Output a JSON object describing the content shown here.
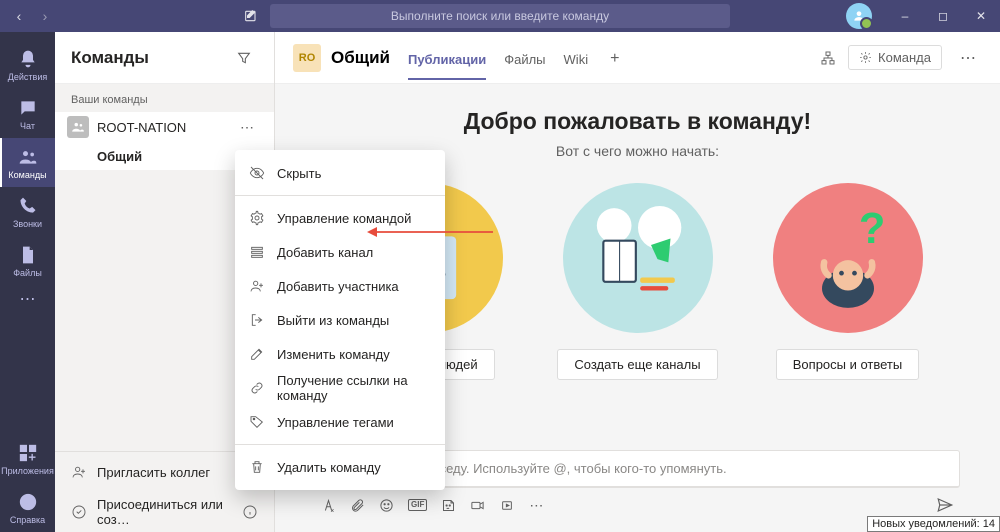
{
  "titlebar": {
    "search_placeholder": "Выполните поиск или введите команду"
  },
  "rail": {
    "items": [
      {
        "label": "Действия"
      },
      {
        "label": "Чат"
      },
      {
        "label": "Команды"
      },
      {
        "label": "Звонки"
      },
      {
        "label": "Файлы"
      }
    ],
    "apps": "Приложения",
    "help": "Справка"
  },
  "panel": {
    "title": "Команды",
    "your_teams": "Ваши команды",
    "team_name": "ROOT-NATION",
    "channel_name": "Общий",
    "invite": "Пригласить коллег",
    "join": "Присоединиться или соз…"
  },
  "header": {
    "avatar": "RO",
    "channel": "Общий",
    "tabs": [
      "Публикации",
      "Файлы",
      "Wiki"
    ],
    "team_btn": "Команда"
  },
  "welcome": {
    "title": "Добро пожаловать в команду!",
    "subtitle": "Вот с чего можно начать:",
    "cards": [
      {
        "btn": "Добавить людей"
      },
      {
        "btn": "Создать еще каналы"
      },
      {
        "btn": "Вопросы и ответы"
      }
    ]
  },
  "compose": {
    "placeholder": "Начните новую беседу. Используйте @, чтобы кого-то упомянуть."
  },
  "context_menu": {
    "items": [
      "Скрыть",
      "Управление командой",
      "Добавить канал",
      "Добавить участника",
      "Выйти из команды",
      "Изменить команду",
      "Получение ссылки на команду",
      "Управление тегами",
      "Удалить команду"
    ]
  },
  "notification": "Новых уведомлений: 14"
}
